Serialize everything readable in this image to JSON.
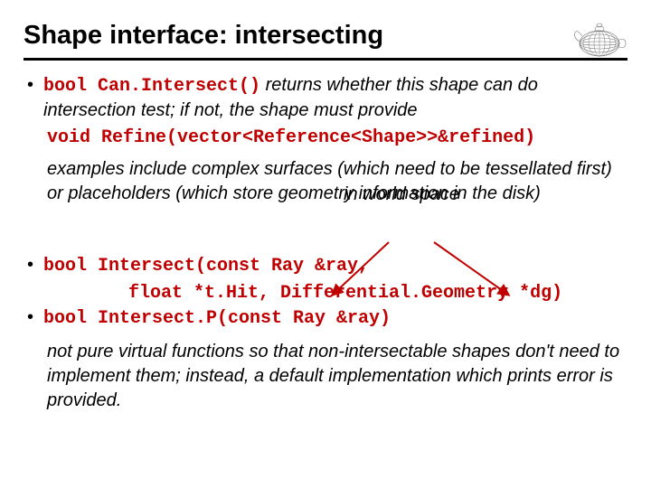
{
  "title": "Shape interface: intersecting",
  "bullets": {
    "b1": {
      "code1": "bool Can.Intersect()",
      "text1": " returns whether this shape can do intersection test; if not, the shape must provide",
      "code2": "void Refine(vector<Reference<Shape>>&refined)"
    },
    "para1": "examples include complex surfaces (which need to be tessellated first) or placeholders (which store geometry information in the disk)",
    "annotation": "in world space",
    "b2": {
      "line1_code": "bool Intersect(const Ray &ray,",
      "line2_code": "float *t.Hit, Differential.Geometry *dg)"
    },
    "b3": {
      "code": "bool Intersect.P(const Ray &ray)"
    },
    "para2": "not pure virtual functions so that non-intersectable shapes don't need to implement them; instead, a default implementation which prints error is provided."
  }
}
